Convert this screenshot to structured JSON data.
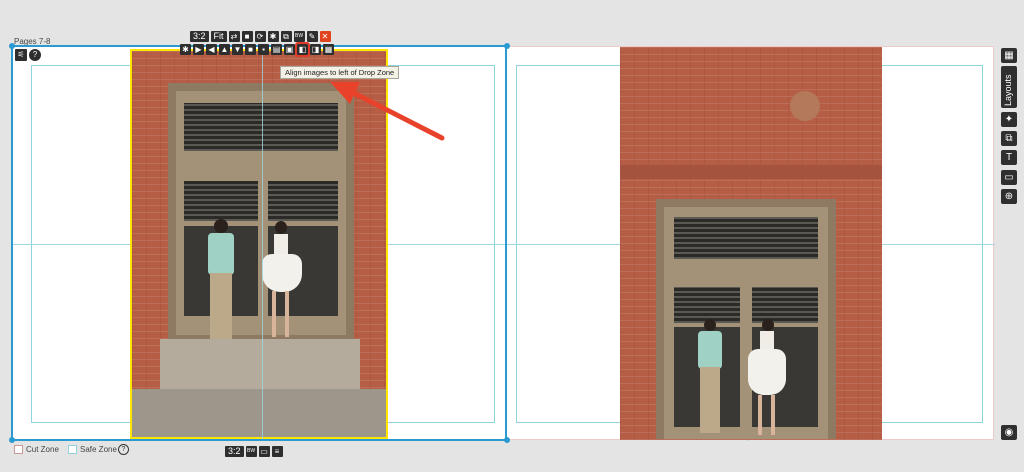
{
  "page_label": "Pages 7-8",
  "toolbar_top": {
    "buttons": [
      {
        "name": "aspect-ratio-button",
        "label": "3:2"
      },
      {
        "name": "fit-button",
        "label": "Fit"
      },
      {
        "name": "swap-icon",
        "label": ""
      },
      {
        "name": "stop-icon",
        "label": "■"
      },
      {
        "name": "rotate-icon",
        "label": "⟳"
      },
      {
        "name": "settings-icon",
        "label": "✱"
      },
      {
        "name": "link-icon",
        "label": "⧉"
      },
      {
        "name": "bw-button",
        "label": "BW"
      },
      {
        "name": "edit-icon",
        "label": "✎"
      },
      {
        "name": "close-button",
        "label": "✕"
      }
    ],
    "align_buttons": [
      "✱",
      "▶",
      "◀",
      "▲",
      "▼",
      "■",
      "▪",
      "▤",
      "▣",
      "◧",
      "◨",
      "▦"
    ]
  },
  "tooltip": "Align images to left of Drop Zone",
  "side_panel": {
    "layouts_label": "Layouts",
    "icons": [
      "grid-icon",
      "pin-icon",
      "duplicate-icon",
      "text-icon",
      "image-icon",
      "zoom-icon"
    ]
  },
  "footer": {
    "cut_zone": "Cut Zone",
    "safe_zone": "Safe Zone",
    "help": "?",
    "bottom_buttons": [
      "3:2",
      "BW",
      "▭",
      "≡"
    ]
  },
  "corner_help": "?",
  "colors": {
    "selection": "#2a9ad2",
    "highlight": "#ffe600",
    "accent": "#e03a2a"
  }
}
